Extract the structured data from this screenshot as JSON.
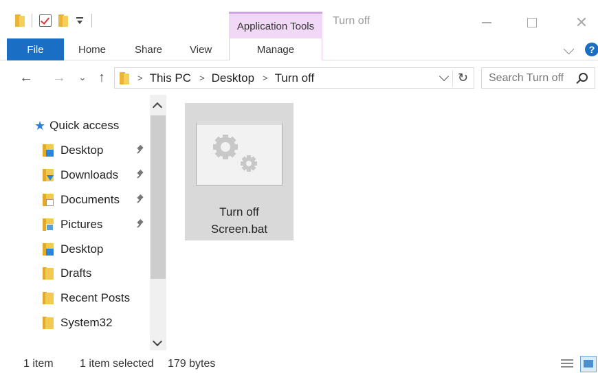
{
  "window": {
    "title": "Turn off",
    "context_group": "Application Tools"
  },
  "ribbon": {
    "tabs": [
      {
        "label": "File"
      },
      {
        "label": "Home"
      },
      {
        "label": "Share"
      },
      {
        "label": "View"
      },
      {
        "label": "Manage"
      }
    ],
    "help_label": "?"
  },
  "address": {
    "crumbs": [
      "This PC",
      "Desktop",
      "Turn off"
    ],
    "separator": ">"
  },
  "search": {
    "placeholder": "Search Turn off"
  },
  "navpane": {
    "quick_access": "Quick access",
    "items": [
      {
        "label": "Desktop",
        "icon": "desktop-folder-icon",
        "pinned": true
      },
      {
        "label": "Downloads",
        "icon": "downloads-folder-icon",
        "pinned": true
      },
      {
        "label": "Documents",
        "icon": "documents-folder-icon",
        "pinned": true
      },
      {
        "label": "Pictures",
        "icon": "pictures-folder-icon",
        "pinned": true
      },
      {
        "label": "Desktop",
        "icon": "desktop-folder-icon",
        "pinned": false
      },
      {
        "label": "Drafts",
        "icon": "folder-icon",
        "pinned": false
      },
      {
        "label": "Recent Posts",
        "icon": "folder-icon",
        "pinned": false
      },
      {
        "label": "System32",
        "icon": "folder-icon",
        "pinned": false
      }
    ]
  },
  "content": {
    "files": [
      {
        "name_line1": "Turn off",
        "name_line2": "Screen.bat",
        "icon": "batch-file-gears-icon",
        "selected": true
      }
    ]
  },
  "status": {
    "count": "1 item",
    "selection": "1 item selected",
    "size": "179 bytes"
  },
  "colors": {
    "accent": "#1a6fc4",
    "context_tab": "#f0d8f6",
    "selected_tile": "#d9d9d9"
  }
}
